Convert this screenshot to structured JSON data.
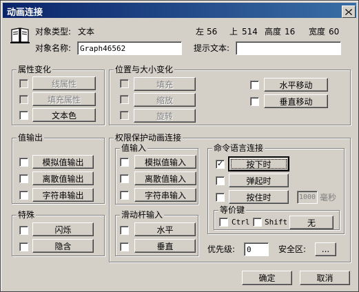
{
  "window": {
    "title": "动画连接"
  },
  "object": {
    "type_label": "对象类型:",
    "type_value": "文本",
    "left_label": "左",
    "left_value": "56",
    "top_label": "上",
    "top_value": "514",
    "height_label": "高度",
    "height_value": "16",
    "width_label": "宽度",
    "width_value": "60",
    "name_label": "对象名称:",
    "name_value": "Graph46562",
    "hint_label": "提示文本:",
    "hint_value": ""
  },
  "attribute_group": {
    "title": "属性变化",
    "line_attr": "线属性",
    "fill_attr": "填充属性",
    "text_color": "文本色"
  },
  "position_group": {
    "title": "位置与大小变化",
    "fill": "填充",
    "scale": "缩放",
    "rotate": "旋转",
    "horizontal_move": "水平移动",
    "vertical_move": "垂直移动"
  },
  "value_output_group": {
    "title": "值输出",
    "analog": "模拟值输出",
    "discrete": "离散值输出",
    "string": "字符串输出"
  },
  "permission_group": {
    "title": "权限保护动画连接",
    "value_input_title": "值输入",
    "analog_input": "模拟值输入",
    "discrete_input": "离散值输入",
    "string_input": "字符串输入",
    "slider_title": "滑动杆输入",
    "slider_horizontal": "水平",
    "slider_vertical": "垂直",
    "command_title": "命令语言连接",
    "press": "按下时",
    "release": "弹起时",
    "hold": "按住时",
    "hold_ms_value": "1000",
    "hold_ms_unit": "毫秒",
    "equiv_key_title": "等价键",
    "ctrl": "Ctrl",
    "shift": "Shift",
    "key_value": "无",
    "priority_label": "优先级:",
    "priority_value": "0",
    "security_label": "安全区:",
    "security_button": "..."
  },
  "special_group": {
    "title": "特殊",
    "blink": "闪烁",
    "hide": "隐含"
  },
  "footer": {
    "ok": "确定",
    "cancel": "取消"
  },
  "icons": {
    "book": "open-book-icon",
    "close": "close-x-icon",
    "check": "checkmark"
  },
  "colors": {
    "title_start": "#0a246a",
    "title_end": "#3a6ea5",
    "face": "#d4d0c8"
  }
}
